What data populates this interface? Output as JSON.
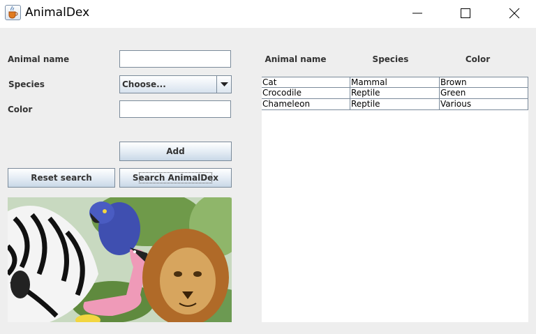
{
  "window": {
    "title": "AnimalDex",
    "controls": [
      "minimize",
      "maximize",
      "close"
    ]
  },
  "form": {
    "name_label": "Animal name",
    "name_value": "",
    "species_label": "Species",
    "species_selected": "Choose...",
    "color_label": "Color",
    "color_value": ""
  },
  "buttons": {
    "add": "Add",
    "reset": "Reset search",
    "search": "Search AnimalDex"
  },
  "picture": {
    "description_icon": "animals-illustration"
  },
  "table": {
    "headers": [
      "Animal name",
      "Species",
      "Color"
    ],
    "rows": [
      [
        "Cat",
        "Mammal",
        "Brown"
      ],
      [
        "Crocodile",
        "Reptile",
        "Green"
      ],
      [
        "Chameleon",
        "Reptile",
        "Various"
      ]
    ]
  },
  "colors": {
    "window_bg": "#eeeeee",
    "titlebar_bg": "#ffffff",
    "border": "#7a8a9a",
    "label_text": "#333333"
  }
}
